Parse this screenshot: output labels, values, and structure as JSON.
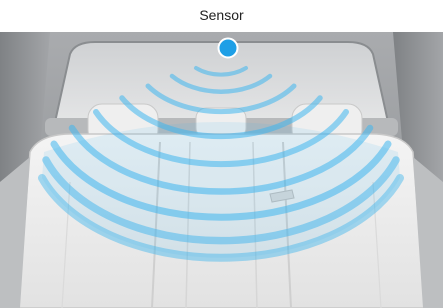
{
  "caption": "Sensor",
  "colors": {
    "sensor_dot": "#1e9fe6",
    "wave": "#3fb6ee",
    "background": "#ffffff",
    "interior_dark": "#9a9c9f",
    "seat": "#efefef"
  },
  "icons": {
    "sensor": "sensor-dot-icon"
  }
}
